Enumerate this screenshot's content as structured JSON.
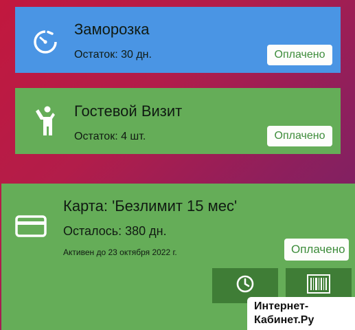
{
  "cards": {
    "freeze": {
      "title": "Заморозка",
      "remaining": "Остаток: 30 дн.",
      "status": "Оплачено",
      "icon": "timer-icon",
      "color": "#4a95e4"
    },
    "guest": {
      "title": "Гостевой Визит",
      "remaining": "Остаток: 4 шт.",
      "status": "Оплачено",
      "icon": "person-icon",
      "color": "#65ad58"
    },
    "membership": {
      "title": "Карта: 'Безлимит 15 мес'",
      "remaining": "Осталось: 380 дн.",
      "active_until": "Активен до 23 октября 2022 г.",
      "status": "Оплачено",
      "icon": "card-icon",
      "color": "#65ad58",
      "actions": {
        "clock_icon": "clock-icon",
        "barcode_icon": "barcode-icon"
      }
    }
  },
  "watermark": {
    "line1": "Интернет-",
    "line2": "Кабинет.Ру"
  },
  "colors": {
    "paid_text": "#3d8c3a",
    "action_button": "#3f7d36"
  }
}
